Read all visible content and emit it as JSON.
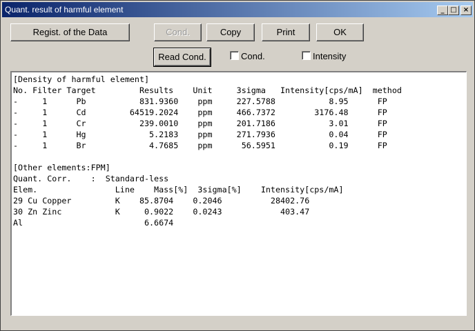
{
  "window": {
    "title": "Quant. result of harmful element",
    "minimize_glyph": "_",
    "maximize_glyph": "□",
    "close_glyph": "×"
  },
  "toolbar": {
    "regist_label": "Regist. of the Data",
    "cond_label": "Cond.",
    "copy_label": "Copy",
    "print_label": "Print",
    "ok_label": "OK",
    "read_cond_label": "Read Cond.",
    "cond_check_label": "Cond.",
    "intensity_check_label": "Intensity"
  },
  "report": {
    "lines": [
      "[Density of harmful element]",
      "No. Filter Target         Results    Unit     3sigma   Intensity[cps/mA]  method",
      "-     1      Pb           831.9360    ppm     227.5788           8.95      FP",
      "-     1      Cd         64519.2024    ppm     466.7372        3176.48      FP",
      "-     1      Cr           239.0010    ppm     201.7186           3.01      FP",
      "-     1      Hg             5.2183    ppm     271.7936           0.04      FP",
      "-     1      Br             4.7685    ppm      56.5951           0.19      FP",
      "",
      "[Other elements:FPM]",
      "Quant. Corr.    :  Standard-less",
      "Elem.                Line    Mass[%]  3sigma[%]    Intensity[cps/mA]",
      "29 Cu Copper         K    85.8704    0.2046          28402.76",
      "30 Zn Zinc           K     0.9022    0.0243            403.47",
      "Al                         6.6674"
    ]
  }
}
